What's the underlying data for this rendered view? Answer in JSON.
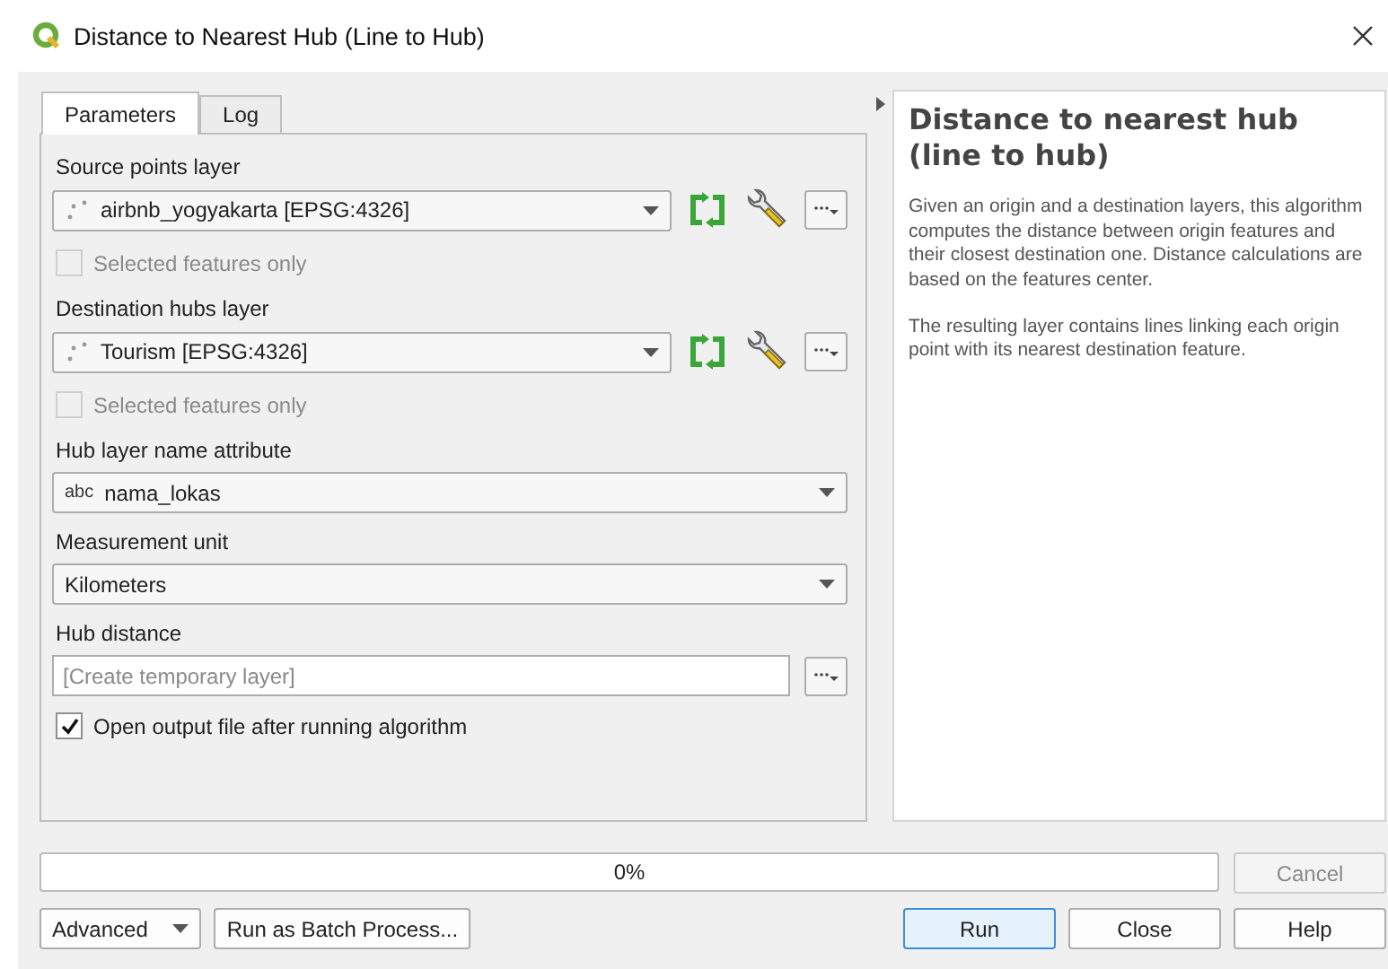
{
  "window": {
    "title": "Distance to Nearest Hub (Line to Hub)"
  },
  "tabs": [
    {
      "label": "Parameters",
      "selected": true
    },
    {
      "label": "Log",
      "selected": false
    }
  ],
  "parameters": [
    {
      "kind": "layer",
      "label": "Source points layer",
      "value": "airbnb_yogyakarta [EPSG:4326]",
      "option": {
        "label": "Selected features only",
        "checked": false,
        "disabled": true
      }
    },
    {
      "kind": "layer",
      "label": "Destination hubs layer",
      "value": "Tourism [EPSG:4326]",
      "option": {
        "label": "Selected features only",
        "checked": false,
        "disabled": true
      }
    },
    {
      "kind": "field",
      "label": "Hub layer name attribute",
      "type_tag": "abc",
      "value": "nama_lokas"
    },
    {
      "kind": "enum",
      "label": "Measurement unit",
      "value": "Kilometers"
    },
    {
      "kind": "output",
      "label": "Hub distance",
      "placeholder": "[Create temporary layer]"
    },
    {
      "kind": "checkbox",
      "label": "Open output file after running algorithm",
      "checked": true
    }
  ],
  "help": {
    "title": "Distance to nearest hub (line to hub)",
    "paragraphs": [
      "Given an origin and a destination layers, this algorithm computes the distance between origin features and their closest destination one. Distance calculations are based on the features center.",
      "The resulting layer contains lines linking each origin point with its nearest destination feature."
    ]
  },
  "progress": {
    "level": 0,
    "reading": "0%"
  },
  "cancel_button": {
    "label": "Cancel",
    "disabled": true
  },
  "left_buttons": [
    {
      "kind": "menu",
      "label": "Advanced"
    },
    {
      "kind": "plain",
      "label": "Run as Batch Process..."
    }
  ],
  "right_buttons": [
    {
      "label": "Run",
      "default": true
    },
    {
      "label": "Close",
      "default": false
    },
    {
      "label": "Help",
      "default": false
    }
  ]
}
